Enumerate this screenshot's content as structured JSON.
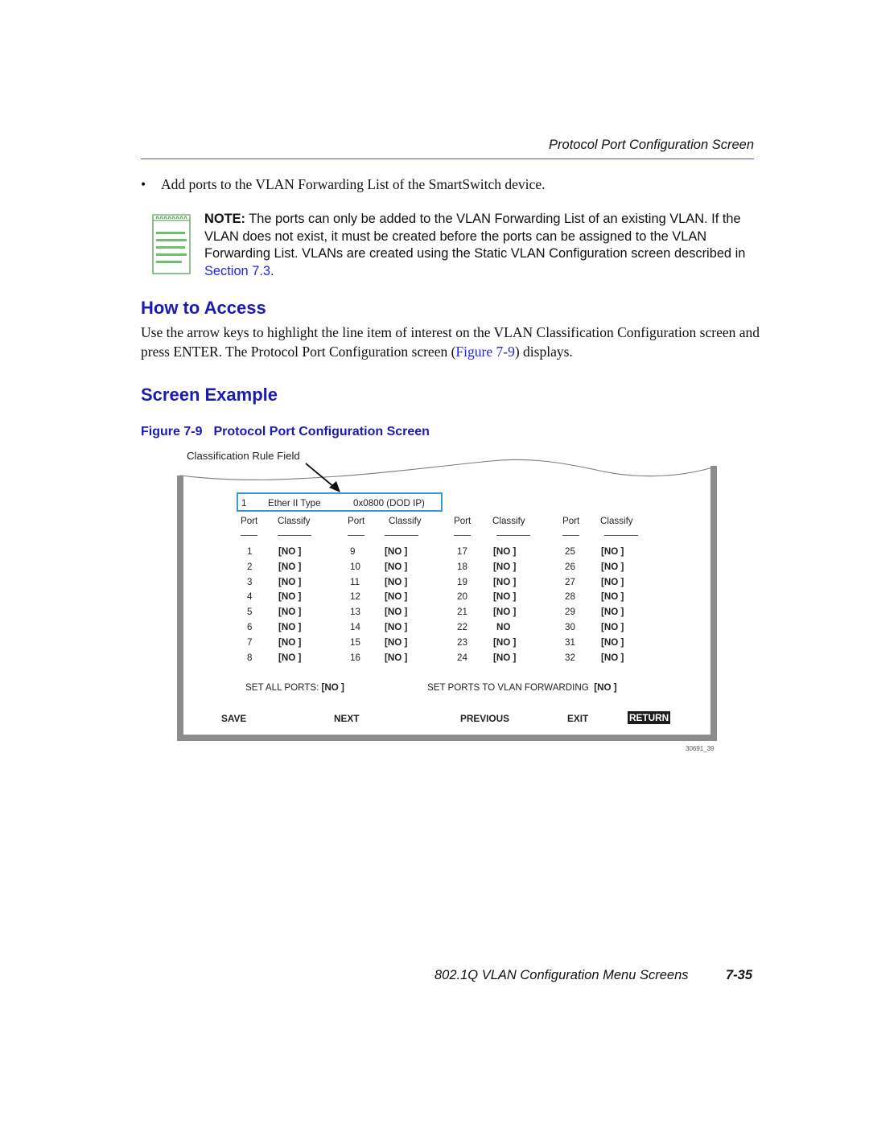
{
  "running_head": "Protocol Port Configuration Screen",
  "bullet": {
    "symbol": "•",
    "text": "Add ports to the VLAN Forwarding List of the SmartSwitch device."
  },
  "note": {
    "icon": "notepad-icon",
    "label": "NOTE:",
    "text_before_link": " The ports can only be added to the VLAN Forwarding List of an existing VLAN. If the VLAN does not exist, it must be created before the ports can be assigned to the VLAN Forwarding List. VLANs are created using the Static VLAN Configuration screen described in ",
    "link": "Section 7.3",
    "text_after_link": "."
  },
  "how_to_access": {
    "heading": "How to Access",
    "text_before_link": "Use the arrow keys to highlight the line item of interest on the VLAN Classification Configuration screen and press ENTER. The Protocol Port Configuration screen (",
    "link": "Figure 7-9",
    "text_after_link": ") displays."
  },
  "screen_example": {
    "heading": "Screen Example",
    "figure_number": "Figure 7-9",
    "figure_title": "Protocol Port Configuration Screen"
  },
  "figure": {
    "callout": "Classification Rule Field",
    "rule": {
      "index": "1",
      "type": "Ether II Type",
      "value": "0x0800  (DOD IP)"
    },
    "column_headers": {
      "port": "Port",
      "classify": "Classify"
    },
    "columns": [
      {
        "ports": [
          {
            "port": "1",
            "value": "[NO ]"
          },
          {
            "port": "2",
            "value": "[NO ]"
          },
          {
            "port": "3",
            "value": "[NO ]"
          },
          {
            "port": "4",
            "value": "[NO ]"
          },
          {
            "port": "5",
            "value": "[NO ]"
          },
          {
            "port": "6",
            "value": "[NO ]"
          },
          {
            "port": "7",
            "value": "[NO ]"
          },
          {
            "port": "8",
            "value": "[NO ]"
          }
        ]
      },
      {
        "ports": [
          {
            "port": "9",
            "value": "[NO ]"
          },
          {
            "port": "10",
            "value": "[NO ]"
          },
          {
            "port": "11",
            "value": "[NO ]"
          },
          {
            "port": "12",
            "value": "[NO ]"
          },
          {
            "port": "13",
            "value": "[NO ]"
          },
          {
            "port": "14",
            "value": "[NO ]"
          },
          {
            "port": "15",
            "value": "[NO ]"
          },
          {
            "port": "16",
            "value": "[NO ]"
          }
        ]
      },
      {
        "ports": [
          {
            "port": "17",
            "value": "[NO ]"
          },
          {
            "port": "18",
            "value": "[NO ]"
          },
          {
            "port": "19",
            "value": "[NO ]"
          },
          {
            "port": "20",
            "value": "[NO ]"
          },
          {
            "port": "21",
            "value": "[NO ]"
          },
          {
            "port": "22",
            "value": "NO"
          },
          {
            "port": "23",
            "value": "[NO ]"
          },
          {
            "port": "24",
            "value": "[NO ]"
          }
        ]
      },
      {
        "ports": [
          {
            "port": "25",
            "value": "[NO ]"
          },
          {
            "port": "26",
            "value": "[NO ]"
          },
          {
            "port": "27",
            "value": "[NO ]"
          },
          {
            "port": "28",
            "value": "[NO ]"
          },
          {
            "port": "29",
            "value": "[NO ]"
          },
          {
            "port": "30",
            "value": "[NO ]"
          },
          {
            "port": "31",
            "value": "[NO ]"
          },
          {
            "port": "32",
            "value": "[NO ]"
          }
        ]
      }
    ],
    "set_all_ports": {
      "label": "SET ALL PORTS: ",
      "value": "[NO ]"
    },
    "set_vlan_forwarding": {
      "label": "SET PORTS TO VLAN FORWARDING  ",
      "value": "[NO ]"
    },
    "commands": {
      "save": "SAVE",
      "next": "NEXT",
      "previous": "PREVIOUS",
      "exit": "EXIT",
      "return": "RETURN"
    },
    "figure_id": "30691_39"
  },
  "footer": {
    "title": "802.1Q VLAN Configuration Menu Screens",
    "page": "7-35"
  },
  "colors": {
    "heading_blue": "#1a1ab4",
    "link_blue": "#2222ee",
    "rule_box_border": "#3b9bd6",
    "note_icon_green": "#5aa85a",
    "frame_gray": "#8c8c8e"
  }
}
